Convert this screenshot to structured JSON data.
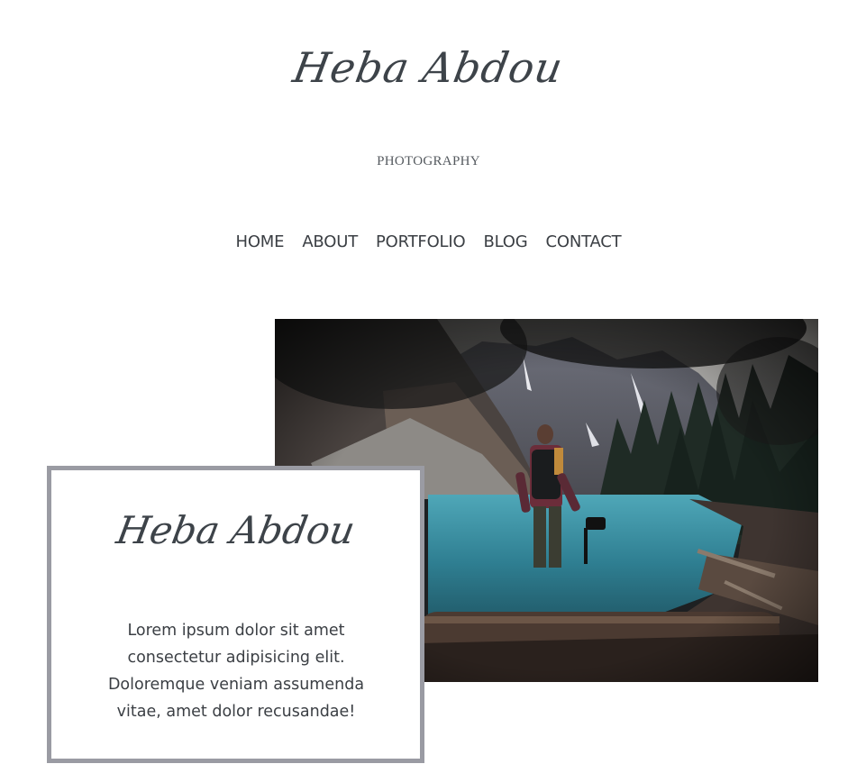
{
  "header": {
    "logo_text": "Heba Abdou",
    "tagline": "PHOTOGRAPHY"
  },
  "nav": {
    "items": [
      {
        "label": "HOME"
      },
      {
        "label": "ABOUT"
      },
      {
        "label": "PORTFOLIO"
      },
      {
        "label": "BLOG"
      },
      {
        "label": "CONTACT"
      }
    ]
  },
  "hero": {
    "image_subject": "hiker-with-camera-at-mountain-lake-photo"
  },
  "card": {
    "logo_text": "Heba Abdou",
    "body": "Lorem ipsum dolor sit amet consectetur adipisicing elit. Doloremque veniam assumenda vitae, amet dolor recusandae!"
  },
  "colors": {
    "text": "#3b3f44",
    "card_border": "#9a9ba3",
    "background": "#ffffff",
    "lake": "#3b8ea0"
  }
}
